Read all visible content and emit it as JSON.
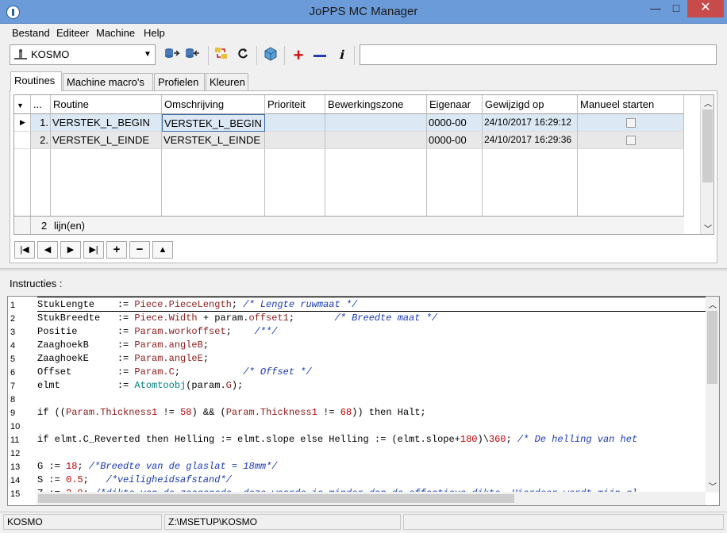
{
  "window": {
    "title": "JoPPS MC Manager",
    "min": "—",
    "max": "□",
    "close": "✕"
  },
  "menu": [
    "Bestand",
    "Editeer",
    "Machine",
    "Help"
  ],
  "toolbar": {
    "machine": "KOSMO",
    "command": ""
  },
  "tabs": [
    "Routines",
    "Machine macro's",
    "Profielen",
    "Kleuren"
  ],
  "grid": {
    "columns": [
      "...",
      "Routine",
      "Omschrijving",
      "Prioriteit",
      "Bewerkingszone",
      "Eigenaar",
      "Gewijzigd op",
      "Manueel starten"
    ],
    "rows": [
      {
        "nr": "1.",
        "routine": "VERSTEK_L_BEGIN",
        "omschrijving": "VERSTEK_L_BEGIN",
        "prioriteit": "",
        "zone": "",
        "eigenaar": "0000-00",
        "gewijzigd": "24/10/2017 16:29:12"
      },
      {
        "nr": "2.",
        "routine": "VERSTEK_L_EINDE",
        "omschrijving": "VERSTEK_L_EINDE",
        "prioriteit": "",
        "zone": "",
        "eigenaar": "0000-00",
        "gewijzigd": "24/10/2017 16:29:36"
      }
    ],
    "footer_count": "2",
    "footer_label": "lijn(en)"
  },
  "instructies_label": "Instructies :",
  "line_numbers": [
    "1",
    "2",
    "3",
    "4",
    "5",
    "6",
    "7",
    "8",
    "9",
    "10",
    "11",
    "12",
    "13",
    "14",
    "15"
  ],
  "status": {
    "machine": "KOSMO",
    "path": "Z:\\MSETUP\\KOSMO"
  }
}
